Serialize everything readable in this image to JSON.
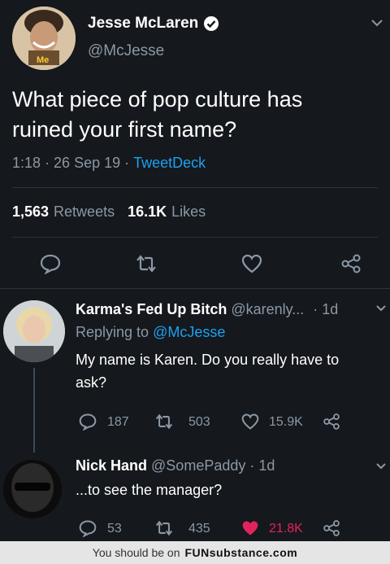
{
  "tweet": {
    "author_name": "Jesse McLaren",
    "author_handle": "@McJesse",
    "avatar_text": "Me",
    "text_line1": "What piece of pop culture has",
    "text_line2": "ruined your first name?",
    "time": "1:18",
    "date": "26 Sep 19",
    "client": "TweetDeck",
    "retweets_count": "1,563",
    "retweets_label": "Retweets",
    "likes_count": "16.1K",
    "likes_label": "Likes",
    "dot": "·"
  },
  "replies": [
    {
      "name": "Karma's Fed Up Bitch",
      "handle": "@karenly...",
      "age": "· 1d",
      "replying_prefix": "Replying to",
      "replying_handle": "@McJesse",
      "text_line1": "My name is Karen. Do you really have to",
      "text_line2": "ask?",
      "replies": "187",
      "retweets": "503",
      "likes": "15.9K"
    },
    {
      "name": "Nick Hand",
      "handle": "@SomePaddy",
      "age": "· 1d",
      "text_line1": "...to see the manager?",
      "replies": "53",
      "retweets": "435",
      "likes": "21.8K"
    }
  ],
  "footer": {
    "prefix": "You should be on",
    "brand_part1": "FUNsubstance",
    "brand_part2": ".com"
  },
  "colors": {
    "background": "#15181c",
    "accent": "#1da1f2",
    "like": "#e0245e",
    "muted": "#8b98a5"
  }
}
